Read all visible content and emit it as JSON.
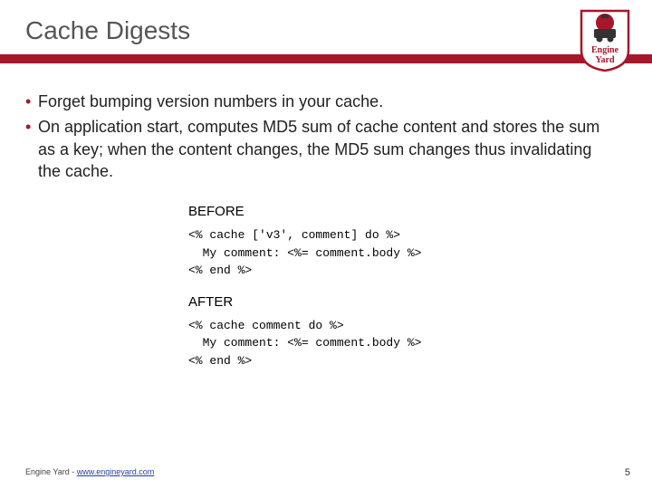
{
  "header": {
    "title": "Cache Digests"
  },
  "logo": {
    "brand_top": "Engine",
    "brand_bottom": "Yard"
  },
  "bullets": [
    "Forget bumping version numbers in your cache.",
    "On application start, computes MD5 sum of cache content and stores the sum as a key; when the content changes, the MD5 sum changes thus invalidating the cache."
  ],
  "code": {
    "before_label": "BEFORE",
    "before_block": "<% cache ['v3', comment] do %>\n  My comment: <%= comment.body %>\n<% end %>",
    "after_label": "AFTER",
    "after_block": "<% cache comment do %>\n  My comment: <%= comment.body %>\n<% end %>"
  },
  "footer": {
    "company": "Engine Yard - ",
    "link_text": "www.engineyard.com"
  },
  "page_number": "5"
}
